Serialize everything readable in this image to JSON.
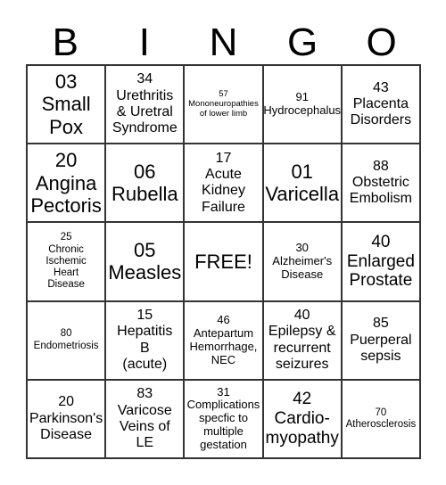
{
  "header": [
    "B",
    "I",
    "N",
    "G",
    "O"
  ],
  "cells": [
    "03\nSmall\nPox",
    "34\nUrethritis\n& Uretral\nSyndrome",
    "57\nMononeuropathies\nof lower limb",
    "91\nHydrocephalus",
    "43\nPlacenta\nDisorders",
    "20\nAngina\nPectoris",
    "06\nRubella",
    "17\nAcute\nKidney\nFailure",
    "01\nVaricella",
    "88\nObstetric\nEmbolism",
    "25\nChronic\nIschemic\nHeart\nDisease",
    "05\nMeasles",
    "FREE!",
    "30\nAlzheimer's\nDisease",
    "40\nEnlarged\nProstate",
    "80\nEndometriosis",
    "15\nHepatitis\nB\n(acute)",
    "46\nAntepartum\nHemorrhage,\nNEC",
    "40\nEpilepsy &\nrecurrent\nseizures",
    "85\nPuerperal\nsepsis",
    "20\nParkinson's\nDisease",
    "83\nVaricose\nVeins of\nLE",
    "31\nComplications\nspecfic to\nmultiple\ngestation",
    "42\nCardio-\nmyopathy",
    "70\nAtherosclerosis"
  ]
}
